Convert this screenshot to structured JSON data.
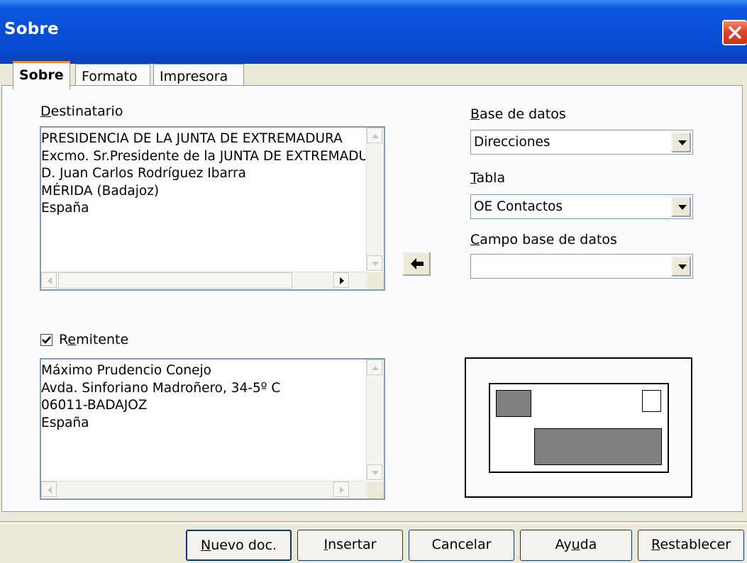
{
  "window": {
    "title": "Sobre"
  },
  "tabs": [
    {
      "label": "Sobre"
    },
    {
      "label": "Formato"
    },
    {
      "label": "Impresora"
    }
  ],
  "recipient": {
    "label_u": "D",
    "label_rest": "estinatario",
    "lines": [
      "PRESIDENCIA DE LA JUNTA DE EXTREMADURA",
      "Excmo. Sr.Presidente de la JUNTA DE EXTREMADURA",
      "D. Juan Carlos Rodríguez Ibarra",
      "MÉRIDA (Badajoz)",
      "España"
    ]
  },
  "database": {
    "label_u": "B",
    "label_rest": "ase de datos",
    "value": "Direcciones"
  },
  "table": {
    "label_u": "T",
    "label_rest": "abla",
    "value": "OE Contactos"
  },
  "db_field": {
    "label_u": "C",
    "label_rest": "ampo base de datos",
    "value": ""
  },
  "sender": {
    "checked": true,
    "label_pre": "R",
    "label_u": "e",
    "label_rest": "mitente",
    "lines": [
      "Máximo Prudencio Conejo",
      "Avda. Sinforiano Madroñero, 34-5º C",
      "06011-BADAJOZ",
      "España"
    ]
  },
  "buttons": {
    "new_doc_u": "N",
    "new_doc_rest": "uevo doc.",
    "insert_u": "I",
    "insert_rest": "nsertar",
    "cancel": "Cancelar",
    "help_pre": "Ay",
    "help_u": "u",
    "help_rest": "da",
    "reset_u": "R",
    "reset_rest": "establecer"
  },
  "icons": [
    "close-icon",
    "scroll-up-arrow",
    "scroll-down-arrow",
    "scroll-left-arrow",
    "scroll-right-arrow",
    "insert-field-left-arrow",
    "dropdown-arrow",
    "checkmark"
  ],
  "colors": {
    "titlebar": "#0a4ad0",
    "close_button": "#e0442a",
    "active_tab_highlight": "#e68b2c",
    "preview_block": "#7f7f7f"
  }
}
